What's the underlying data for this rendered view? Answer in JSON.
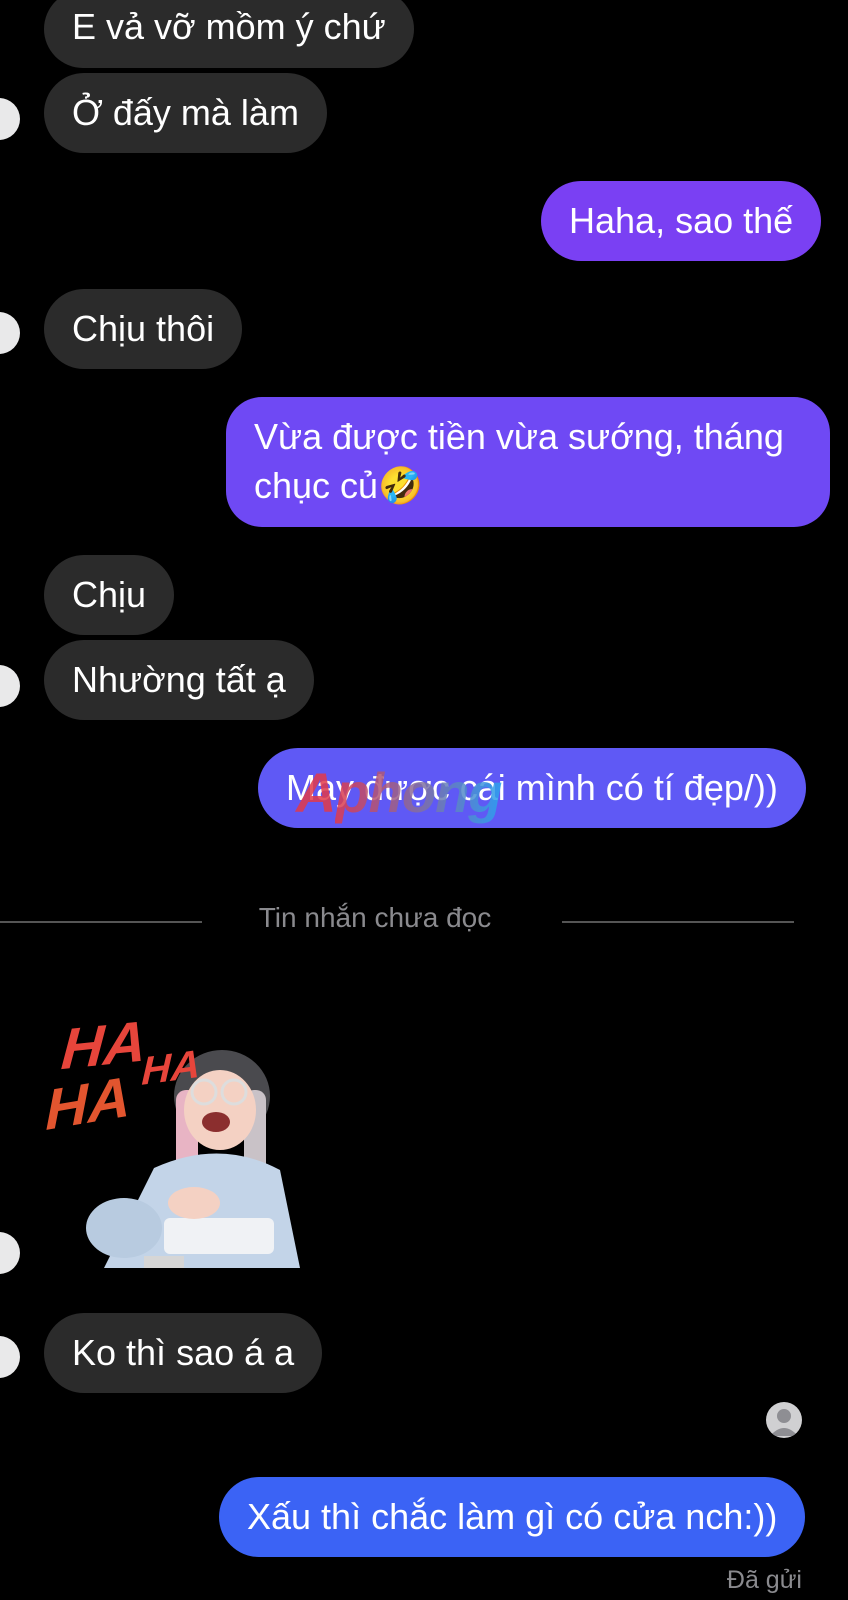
{
  "conversation": {
    "messages": [
      {
        "id": "m1",
        "direction": "in",
        "text": "E vả vỡ mồm ý chứ"
      },
      {
        "id": "m2",
        "direction": "in",
        "text": "Ở đấy mà làm"
      },
      {
        "id": "m3",
        "direction": "out",
        "text": "Haha, sao thế"
      },
      {
        "id": "m4",
        "direction": "in",
        "text": "Chịu thôi"
      },
      {
        "id": "m5",
        "direction": "out",
        "line1": "Vừa được tiền vừa sướng, tháng",
        "line2": "chục củ🤣"
      },
      {
        "id": "m6",
        "direction": "in",
        "text": "Chịu"
      },
      {
        "id": "m7",
        "direction": "in",
        "text": "Nhường tất ạ"
      },
      {
        "id": "m8",
        "direction": "out",
        "text": "May được cái mình có tí đẹp/))"
      },
      {
        "id": "m9",
        "direction": "in",
        "text": "Ko thì sao á a"
      },
      {
        "id": "m10",
        "direction": "out",
        "text": "Xấu thì chắc làm gì có cửa nch:))"
      }
    ],
    "unread_divider": "Tin nhắn chưa đọc",
    "sticker": {
      "text_top": "HA",
      "text_top2": "HA",
      "text_mid": "HA",
      "text_low": "HA"
    },
    "watermark": "Aphong",
    "delivery_status": "Đã gửi"
  },
  "colors": {
    "incoming_bubble": "#2b2b2b",
    "outgoing_purple": "#7a40f3",
    "outgoing_indigo": "#6653f4",
    "outgoing_blue": "#3b63f5",
    "background": "#000000"
  }
}
